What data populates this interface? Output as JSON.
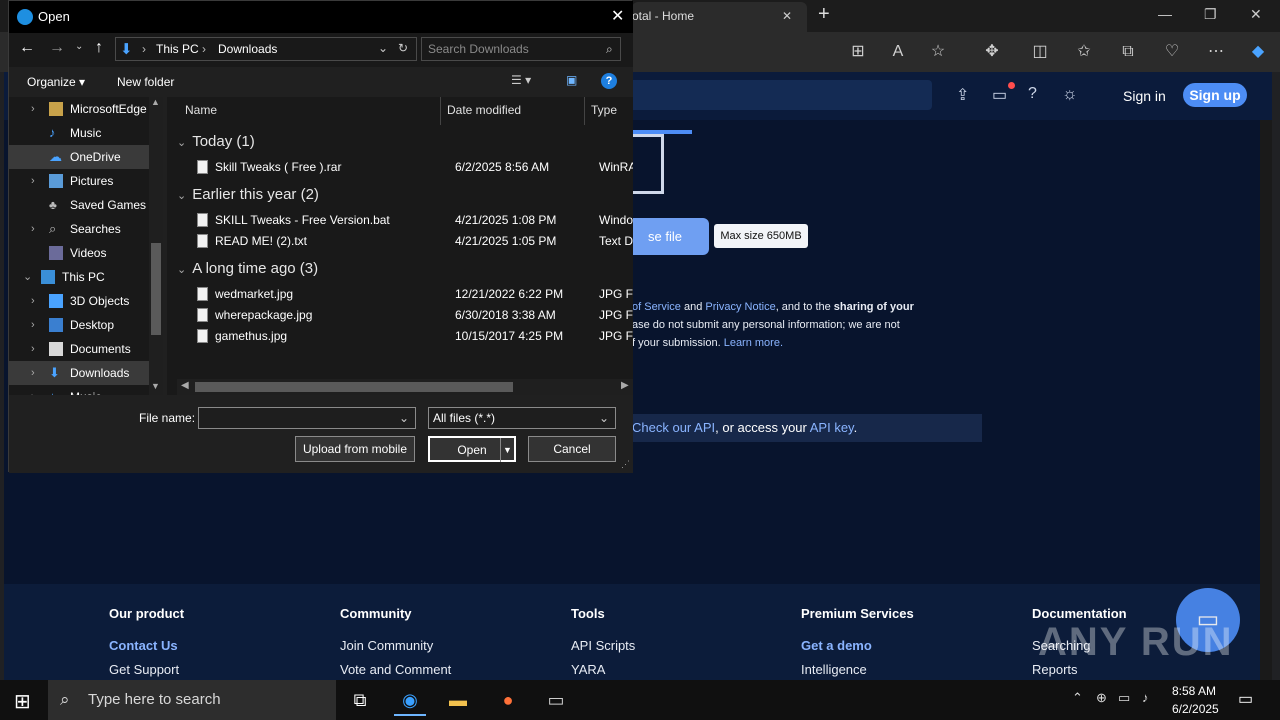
{
  "browser": {
    "tab_title": "otal - Home",
    "close_tab": "✕",
    "new_tab": "+"
  },
  "site": {
    "signin": "Sign in",
    "signup": "Sign up",
    "choose_file": "se file",
    "max_size": "Max size 650MB",
    "terms": {
      "part1": "of Service",
      "and1": " and ",
      "privacy": "Privacy Notice",
      "part2": ", and to the ",
      "sharing": "sharing of your",
      "line2": "ase do not submit any personal information; we are not",
      "line3": "f your submission. ",
      "learn_more": "Learn more."
    },
    "api": {
      "check": "Check our API",
      "middle": ", or access your ",
      "key": "API key",
      "end": "."
    }
  },
  "footer": {
    "columns": [
      {
        "title": "Our product",
        "links": [
          "Contact Us",
          "Get Support"
        ]
      },
      {
        "title": "Community",
        "links": [
          "Join Community",
          "Vote and Comment"
        ]
      },
      {
        "title": "Tools",
        "links": [
          "API Scripts",
          "YARA"
        ]
      },
      {
        "title": "Premium Services",
        "links": [
          "Get a demo",
          "Intelligence"
        ]
      },
      {
        "title": "Documentation",
        "links": [
          "Searching",
          "Reports"
        ]
      }
    ],
    "watermark": "ANY RUN"
  },
  "dialog": {
    "title": "Open",
    "path": [
      "This PC",
      "Downloads"
    ],
    "search_placeholder": "Search Downloads",
    "organize": "Organize",
    "new_folder": "New folder",
    "nav": [
      {
        "label": "MicrosoftEdge",
        "chev": "›",
        "icon": "folder-icon",
        "selected": false
      },
      {
        "label": "Music",
        "chev": "",
        "icon": "music-icon",
        "selected": false
      },
      {
        "label": "OneDrive",
        "chev": "",
        "icon": "cloud-icon",
        "selected": true
      },
      {
        "label": "Pictures",
        "chev": "›",
        "icon": "pictures-icon",
        "selected": false
      },
      {
        "label": "Saved Games",
        "chev": "",
        "icon": "games-icon",
        "selected": false
      },
      {
        "label": "Searches",
        "chev": "›",
        "icon": "searches-icon",
        "selected": false
      },
      {
        "label": "Videos",
        "chev": "",
        "icon": "videos-icon",
        "selected": false
      },
      {
        "label": "This PC",
        "chev": "⌄",
        "icon": "pc-icon",
        "selected": false
      },
      {
        "label": "3D Objects",
        "chev": "›",
        "icon": "3d-icon",
        "selected": false
      },
      {
        "label": "Desktop",
        "chev": "›",
        "icon": "desktop-icon",
        "selected": false
      },
      {
        "label": "Documents",
        "chev": "›",
        "icon": "documents-icon",
        "selected": false
      },
      {
        "label": "Downloads",
        "chev": "›",
        "icon": "downloads-icon",
        "selected": true
      },
      {
        "label": "Music",
        "chev": "›",
        "icon": "music-icon",
        "selected": false
      }
    ],
    "columns": {
      "name": "Name",
      "date": "Date modified",
      "type": "Type"
    },
    "groups": [
      {
        "label": "Today (1)",
        "files": [
          {
            "name": "Skill Tweaks ( Free ).rar",
            "date": "6/2/2025 8:56 AM",
            "type": "WinRAR"
          }
        ]
      },
      {
        "label": "Earlier this year (2)",
        "files": [
          {
            "name": "SKILL Tweaks - Free Version.bat",
            "date": "4/21/2025 1:08 PM",
            "type": "Window"
          },
          {
            "name": "READ ME! (2).txt",
            "date": "4/21/2025 1:05 PM",
            "type": "Text Doc"
          }
        ]
      },
      {
        "label": "A long time ago (3)",
        "files": [
          {
            "name": "wedmarket.jpg",
            "date": "12/21/2022 6:22 PM",
            "type": "JPG File"
          },
          {
            "name": "wherepackage.jpg",
            "date": "6/30/2018 3:38 AM",
            "type": "JPG File"
          },
          {
            "name": "gamethus.jpg",
            "date": "10/15/2017 4:25 PM",
            "type": "JPG File"
          }
        ]
      }
    ],
    "file_name_label": "File name:",
    "file_name_value": "",
    "filter": "All files (*.*)",
    "upload_mobile": "Upload from mobile",
    "open": "Open",
    "cancel": "Cancel"
  },
  "taskbar": {
    "search_placeholder": "Type here to search",
    "time": "8:58 AM",
    "date": "6/2/2025"
  },
  "colors": {
    "accent": "#0b5cd5",
    "site_bg": "#08142d",
    "link": "#8ab4ff",
    "signup_bg": "#4d8df5"
  }
}
